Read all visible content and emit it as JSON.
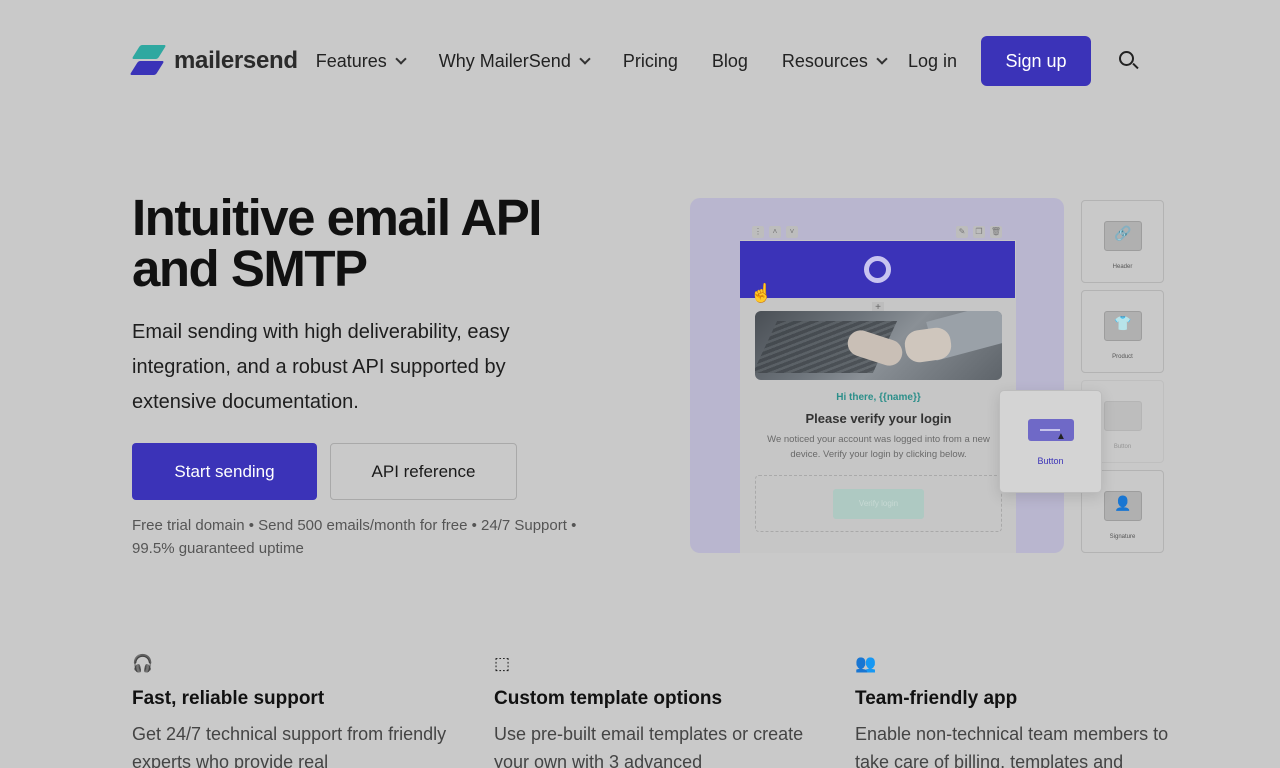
{
  "nav": {
    "logo_text": "mailersend",
    "items": [
      {
        "label": "Features",
        "dropdown": true
      },
      {
        "label": "Why MailerSend",
        "dropdown": true
      },
      {
        "label": "Pricing",
        "dropdown": false
      },
      {
        "label": "Blog",
        "dropdown": false
      },
      {
        "label": "Resources",
        "dropdown": true
      }
    ],
    "login_label": "Log in",
    "signup_label": "Sign up"
  },
  "hero": {
    "title_line1": "Intuitive email API",
    "title_line2": "and SMTP",
    "subtitle": "Email sending with high deliverability, easy integration, and a robust API supported by extensive documentation.",
    "primary_cta": "Start sending",
    "secondary_cta": "API reference",
    "note": "Free trial domain • Send 500 emails/month for free • 24/7 Support • 99.5% guaranteed uptime"
  },
  "mockup": {
    "greeting": "Hi there, {{name}}",
    "email_title": "Please verify your login",
    "email_body": "We noticed your account was logged into from a new device. Verify your login by clicking below.",
    "drop_button_label": "Verify login",
    "side_blocks": [
      {
        "label": "Header",
        "glyph": "🔗"
      },
      {
        "label": "Product",
        "glyph": "👕"
      },
      {
        "label": "Button",
        "glyph": "▭"
      },
      {
        "label": "Signature",
        "glyph": "👤"
      }
    ],
    "dragging_block_label": "Button"
  },
  "features": [
    {
      "icon": "headset-icon",
      "glyph": "🎧",
      "title": "Fast, reliable support",
      "desc": "Get 24/7 technical support from friendly experts who provide real"
    },
    {
      "icon": "template-icon",
      "glyph": "⬚",
      "title": "Custom template options",
      "desc": "Use pre-built email templates or create your own with 3 advanced"
    },
    {
      "icon": "team-icon",
      "glyph": "👥",
      "title": "Team-friendly app",
      "desc": "Enable non-technical team members to take care of billing, templates and"
    }
  ],
  "colors": {
    "brand_purple": "#3b33b8",
    "brand_teal": "#2fa8a0",
    "background": "#c9c9c9"
  }
}
